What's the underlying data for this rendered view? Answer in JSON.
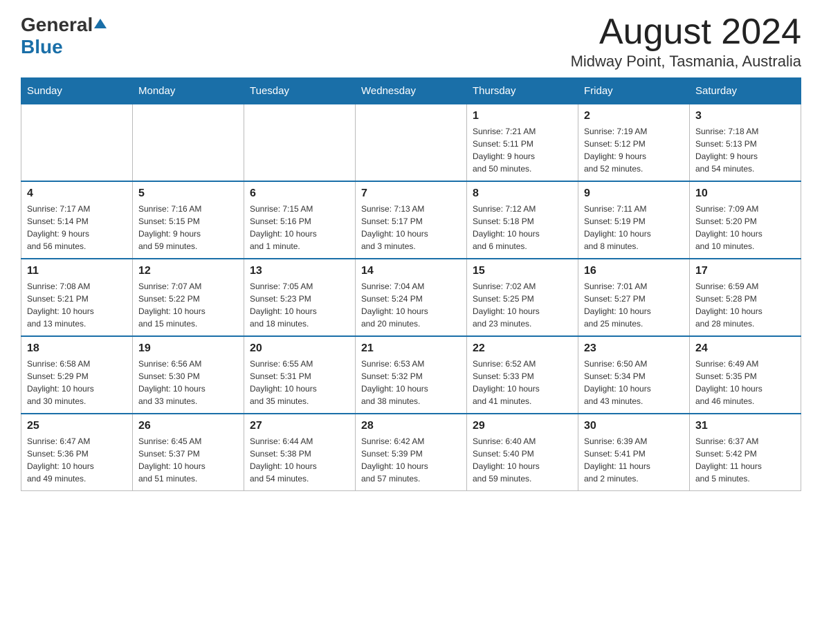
{
  "header": {
    "logo_general": "General",
    "logo_blue": "Blue",
    "month_title": "August 2024",
    "location": "Midway Point, Tasmania, Australia"
  },
  "days_of_week": [
    "Sunday",
    "Monday",
    "Tuesday",
    "Wednesday",
    "Thursday",
    "Friday",
    "Saturday"
  ],
  "weeks": [
    [
      {
        "day": "",
        "info": ""
      },
      {
        "day": "",
        "info": ""
      },
      {
        "day": "",
        "info": ""
      },
      {
        "day": "",
        "info": ""
      },
      {
        "day": "1",
        "info": "Sunrise: 7:21 AM\nSunset: 5:11 PM\nDaylight: 9 hours\nand 50 minutes."
      },
      {
        "day": "2",
        "info": "Sunrise: 7:19 AM\nSunset: 5:12 PM\nDaylight: 9 hours\nand 52 minutes."
      },
      {
        "day": "3",
        "info": "Sunrise: 7:18 AM\nSunset: 5:13 PM\nDaylight: 9 hours\nand 54 minutes."
      }
    ],
    [
      {
        "day": "4",
        "info": "Sunrise: 7:17 AM\nSunset: 5:14 PM\nDaylight: 9 hours\nand 56 minutes."
      },
      {
        "day": "5",
        "info": "Sunrise: 7:16 AM\nSunset: 5:15 PM\nDaylight: 9 hours\nand 59 minutes."
      },
      {
        "day": "6",
        "info": "Sunrise: 7:15 AM\nSunset: 5:16 PM\nDaylight: 10 hours\nand 1 minute."
      },
      {
        "day": "7",
        "info": "Sunrise: 7:13 AM\nSunset: 5:17 PM\nDaylight: 10 hours\nand 3 minutes."
      },
      {
        "day": "8",
        "info": "Sunrise: 7:12 AM\nSunset: 5:18 PM\nDaylight: 10 hours\nand 6 minutes."
      },
      {
        "day": "9",
        "info": "Sunrise: 7:11 AM\nSunset: 5:19 PM\nDaylight: 10 hours\nand 8 minutes."
      },
      {
        "day": "10",
        "info": "Sunrise: 7:09 AM\nSunset: 5:20 PM\nDaylight: 10 hours\nand 10 minutes."
      }
    ],
    [
      {
        "day": "11",
        "info": "Sunrise: 7:08 AM\nSunset: 5:21 PM\nDaylight: 10 hours\nand 13 minutes."
      },
      {
        "day": "12",
        "info": "Sunrise: 7:07 AM\nSunset: 5:22 PM\nDaylight: 10 hours\nand 15 minutes."
      },
      {
        "day": "13",
        "info": "Sunrise: 7:05 AM\nSunset: 5:23 PM\nDaylight: 10 hours\nand 18 minutes."
      },
      {
        "day": "14",
        "info": "Sunrise: 7:04 AM\nSunset: 5:24 PM\nDaylight: 10 hours\nand 20 minutes."
      },
      {
        "day": "15",
        "info": "Sunrise: 7:02 AM\nSunset: 5:25 PM\nDaylight: 10 hours\nand 23 minutes."
      },
      {
        "day": "16",
        "info": "Sunrise: 7:01 AM\nSunset: 5:27 PM\nDaylight: 10 hours\nand 25 minutes."
      },
      {
        "day": "17",
        "info": "Sunrise: 6:59 AM\nSunset: 5:28 PM\nDaylight: 10 hours\nand 28 minutes."
      }
    ],
    [
      {
        "day": "18",
        "info": "Sunrise: 6:58 AM\nSunset: 5:29 PM\nDaylight: 10 hours\nand 30 minutes."
      },
      {
        "day": "19",
        "info": "Sunrise: 6:56 AM\nSunset: 5:30 PM\nDaylight: 10 hours\nand 33 minutes."
      },
      {
        "day": "20",
        "info": "Sunrise: 6:55 AM\nSunset: 5:31 PM\nDaylight: 10 hours\nand 35 minutes."
      },
      {
        "day": "21",
        "info": "Sunrise: 6:53 AM\nSunset: 5:32 PM\nDaylight: 10 hours\nand 38 minutes."
      },
      {
        "day": "22",
        "info": "Sunrise: 6:52 AM\nSunset: 5:33 PM\nDaylight: 10 hours\nand 41 minutes."
      },
      {
        "day": "23",
        "info": "Sunrise: 6:50 AM\nSunset: 5:34 PM\nDaylight: 10 hours\nand 43 minutes."
      },
      {
        "day": "24",
        "info": "Sunrise: 6:49 AM\nSunset: 5:35 PM\nDaylight: 10 hours\nand 46 minutes."
      }
    ],
    [
      {
        "day": "25",
        "info": "Sunrise: 6:47 AM\nSunset: 5:36 PM\nDaylight: 10 hours\nand 49 minutes."
      },
      {
        "day": "26",
        "info": "Sunrise: 6:45 AM\nSunset: 5:37 PM\nDaylight: 10 hours\nand 51 minutes."
      },
      {
        "day": "27",
        "info": "Sunrise: 6:44 AM\nSunset: 5:38 PM\nDaylight: 10 hours\nand 54 minutes."
      },
      {
        "day": "28",
        "info": "Sunrise: 6:42 AM\nSunset: 5:39 PM\nDaylight: 10 hours\nand 57 minutes."
      },
      {
        "day": "29",
        "info": "Sunrise: 6:40 AM\nSunset: 5:40 PM\nDaylight: 10 hours\nand 59 minutes."
      },
      {
        "day": "30",
        "info": "Sunrise: 6:39 AM\nSunset: 5:41 PM\nDaylight: 11 hours\nand 2 minutes."
      },
      {
        "day": "31",
        "info": "Sunrise: 6:37 AM\nSunset: 5:42 PM\nDaylight: 11 hours\nand 5 minutes."
      }
    ]
  ]
}
